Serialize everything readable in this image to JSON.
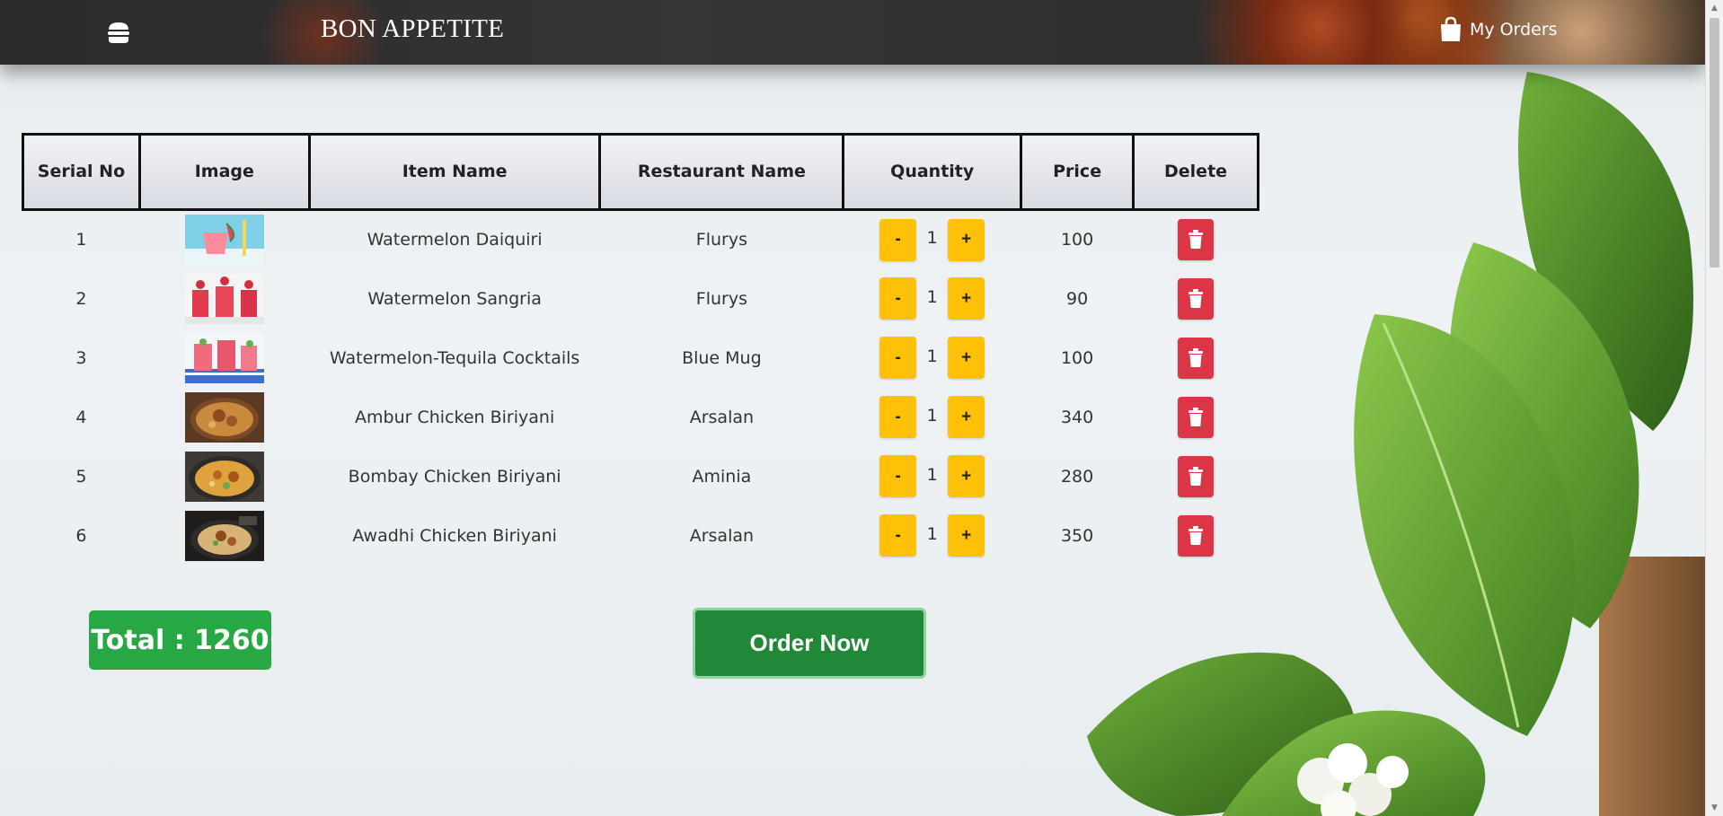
{
  "header": {
    "brand": "BON APPETITE",
    "my_orders_label": "My Orders"
  },
  "table": {
    "headers": {
      "serial": "Serial No",
      "image": "Image",
      "item": "Item Name",
      "restaurant": "Restaurant Name",
      "quantity": "Quantity",
      "price": "Price",
      "delete": "Delete"
    },
    "rows": [
      {
        "serial": "1",
        "item": "Watermelon Daiquiri",
        "restaurant": "Flurys",
        "qty": "1",
        "price": "100",
        "image_icon": "watermelon-drink-image"
      },
      {
        "serial": "2",
        "item": "Watermelon Sangria",
        "restaurant": "Flurys",
        "qty": "1",
        "price": "90",
        "image_icon": "sangria-glasses-image"
      },
      {
        "serial": "3",
        "item": "Watermelon-Tequila Cocktails",
        "restaurant": "Blue Mug",
        "qty": "1",
        "price": "100",
        "image_icon": "cocktail-glasses-image"
      },
      {
        "serial": "4",
        "item": "Ambur Chicken Biriyani",
        "restaurant": "Arsalan",
        "qty": "1",
        "price": "340",
        "image_icon": "biriyani-bowl-image"
      },
      {
        "serial": "5",
        "item": "Bombay Chicken Biriyani",
        "restaurant": "Aminia",
        "qty": "1",
        "price": "280",
        "image_icon": "biriyani-plate-image"
      },
      {
        "serial": "6",
        "item": "Awadhi Chicken Biriyani",
        "restaurant": "Arsalan",
        "qty": "1",
        "price": "350",
        "image_icon": "biriyani-dark-plate-image"
      }
    ],
    "minus_label": "-",
    "plus_label": "+"
  },
  "footer": {
    "total_label": "Total : 1260",
    "order_label": "Order Now"
  },
  "colors": {
    "qty_button": "#ffc107",
    "delete_button": "#dc3545",
    "total_badge": "#28a745",
    "order_button": "#218838"
  }
}
